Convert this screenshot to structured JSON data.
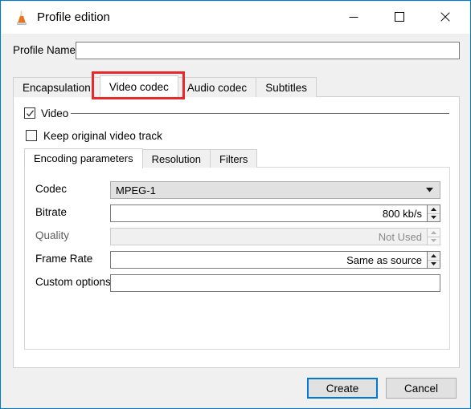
{
  "window": {
    "title": "Profile edition",
    "icon": "vlc-cone-icon",
    "accent_color": "#0078d7",
    "highlight_color": "#e8282b",
    "controls": {
      "minimize": "minimize-icon",
      "maximize": "maximize-icon",
      "close": "close-icon"
    }
  },
  "profile": {
    "label": "Profile Name",
    "value": "",
    "placeholder": ""
  },
  "outer_tabs": {
    "items": [
      {
        "label": "Encapsulation",
        "active": false
      },
      {
        "label": "Video codec",
        "active": true,
        "highlighted": true
      },
      {
        "label": "Audio codec",
        "active": false
      },
      {
        "label": "Subtitles",
        "active": false
      }
    ]
  },
  "video_panel": {
    "video_checkbox": {
      "label": "Video",
      "checked": true
    },
    "keep_original": {
      "label": "Keep original video track",
      "checked": false
    }
  },
  "inner_tabs": {
    "items": [
      {
        "label": "Encoding parameters",
        "active": true
      },
      {
        "label": "Resolution",
        "active": false
      },
      {
        "label": "Filters",
        "active": false
      }
    ]
  },
  "encoding": {
    "rows": [
      {
        "label": "Codec",
        "control": "combobox",
        "value": "MPEG-1",
        "disabled": false,
        "icon": "chevron-down-icon",
        "name": "codec"
      },
      {
        "label": "Bitrate",
        "control": "spinbox",
        "value": "800 kb/s",
        "disabled": false,
        "name": "bitrate"
      },
      {
        "label": "Quality",
        "control": "spinbox",
        "value": "Not Used",
        "disabled": true,
        "name": "quality"
      },
      {
        "label": "Frame Rate",
        "control": "spinbox",
        "value": "Same as source",
        "disabled": false,
        "name": "frame-rate"
      },
      {
        "label": "Custom options",
        "control": "textfield",
        "value": "",
        "placeholder": "",
        "disabled": false,
        "name": "custom-options"
      }
    ]
  },
  "footer": {
    "create_label": "Create",
    "cancel_label": "Cancel"
  }
}
